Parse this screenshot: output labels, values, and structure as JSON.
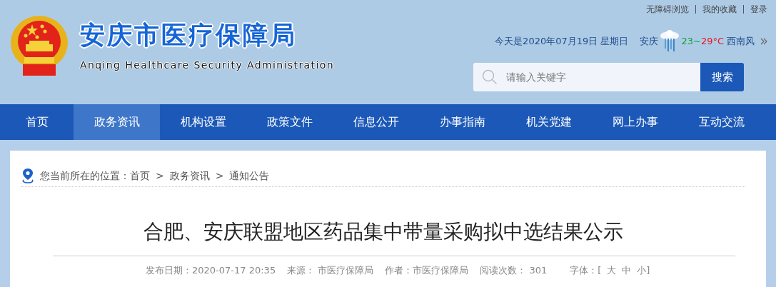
{
  "header": {
    "title": "安庆市医疗保障局",
    "subtitle": "Anqing Healthcare Security Administration",
    "top_links": [
      "无障碍浏览",
      "我的收藏",
      "登录"
    ],
    "date": "今天是2020年07月19日 星期日",
    "city": "安庆",
    "temp_low": "23",
    "temp_sep": "~",
    "temp_high": "29°C",
    "wind": "西南风",
    "search": {
      "placeholder": "请输入关键字",
      "button": "搜索"
    }
  },
  "nav": [
    {
      "label": "首页",
      "selected": false
    },
    {
      "label": "政务资讯",
      "selected": true
    },
    {
      "label": "机构设置",
      "selected": false
    },
    {
      "label": "政策文件",
      "selected": false
    },
    {
      "label": "信息公开",
      "selected": false
    },
    {
      "label": "办事指南",
      "selected": false
    },
    {
      "label": "机关党建",
      "selected": false
    },
    {
      "label": "网上办事",
      "selected": false
    },
    {
      "label": "互动交流",
      "selected": false
    }
  ],
  "breadcrumb": {
    "prefix": "您当前所在的位置：",
    "items": [
      "首页",
      "政务资讯",
      "通知公告"
    ],
    "separator": ">"
  },
  "article": {
    "title": "合肥、安庆联盟地区药品集中带量采购拟中选结果公示",
    "meta": [
      "发布日期：2020-07-17 20:35",
      "来源： 市医疗保障局",
      "作者：市医疗保障局",
      "阅读次数： 301"
    ],
    "font_size": {
      "label": "字体：[",
      "options": [
        "大",
        "中",
        "小]"
      ]
    }
  }
}
